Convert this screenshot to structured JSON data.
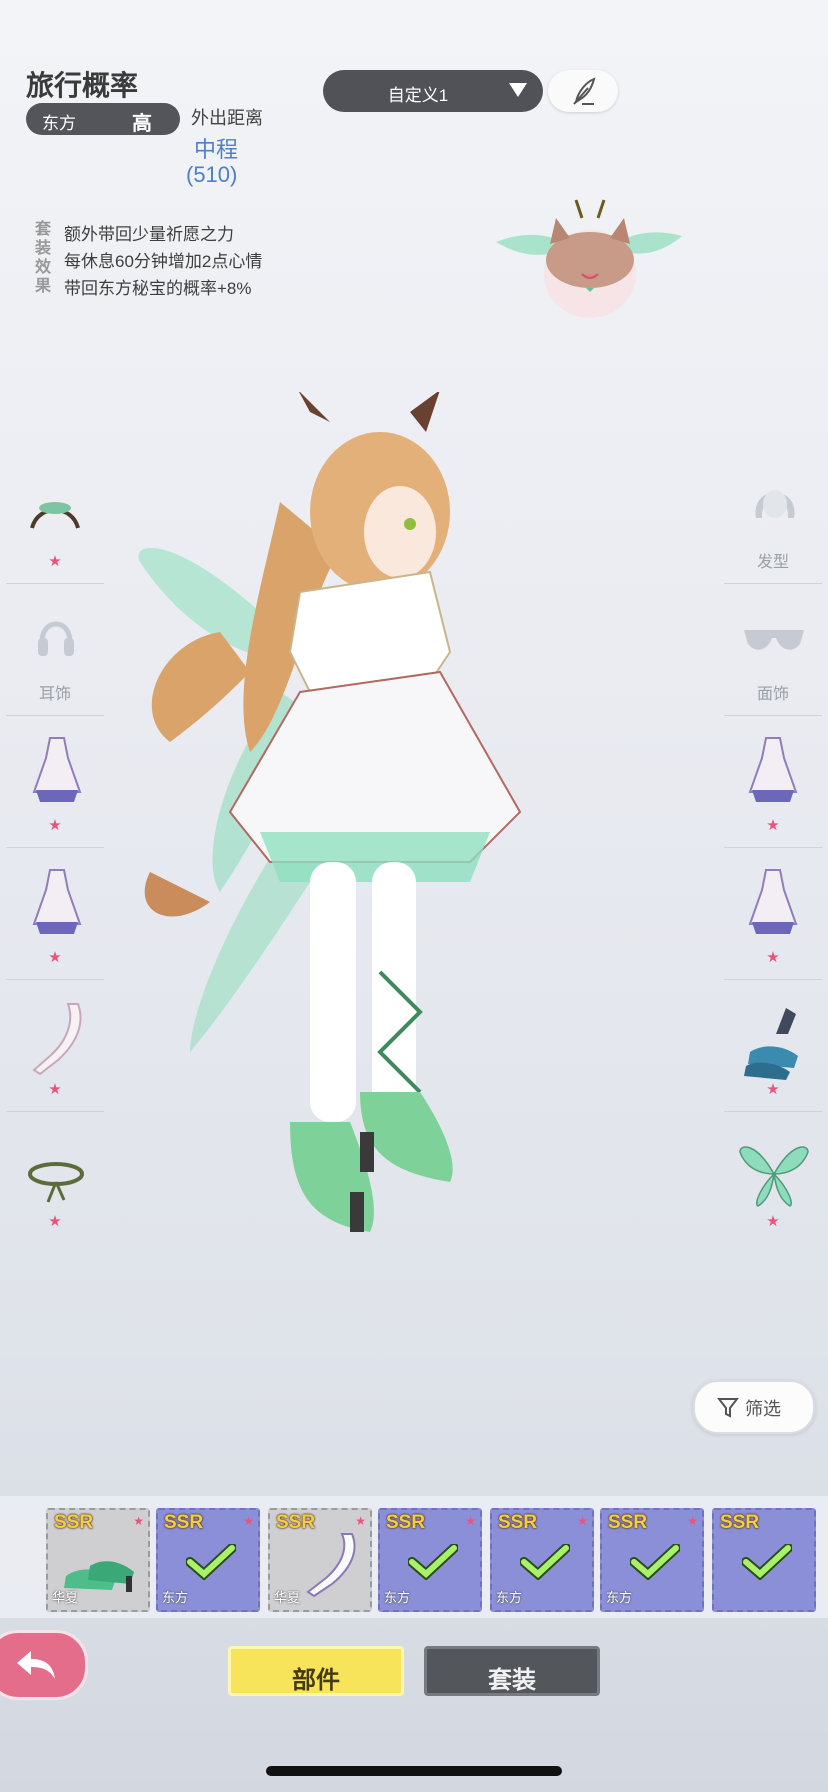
{
  "travel": {
    "title": "旅行概率",
    "region": "东方",
    "probability": "高",
    "distance_label": "外出距离",
    "distance_value": "中程",
    "distance_number": "(510)"
  },
  "set_effect": {
    "tag": "套装效果",
    "lines": [
      "额外带回少量祈愿之力",
      "每休息60分钟增加2点心情",
      "带回东方秘宝的概率+8%"
    ]
  },
  "preset": {
    "label": "自定义1"
  },
  "side_slots": {
    "left": [
      {
        "name": "headwear",
        "icon": "headpiece-icon",
        "star": "★"
      },
      {
        "name": "earrings",
        "label": "耳饰",
        "icon": "headphones-icon"
      },
      {
        "name": "dress-1",
        "icon": "dress-icon",
        "star": "★"
      },
      {
        "name": "dress-2",
        "icon": "dress-icon",
        "star": "★"
      },
      {
        "name": "stockings",
        "icon": "leg-icon",
        "star": "★"
      },
      {
        "name": "accessory",
        "icon": "rope-icon",
        "star": "★"
      }
    ],
    "right": [
      {
        "name": "hairstyle",
        "label": "发型",
        "icon": "hair-icon"
      },
      {
        "name": "face",
        "label": "面饰",
        "icon": "glasses-icon"
      },
      {
        "name": "dress-1",
        "icon": "dress-icon",
        "star": "★"
      },
      {
        "name": "dress-2",
        "icon": "dress-icon",
        "star": "★"
      },
      {
        "name": "shoes",
        "icon": "shoes-icon",
        "star": "★"
      },
      {
        "name": "wings",
        "icon": "wings-icon",
        "star": "★"
      }
    ]
  },
  "filter": {
    "label": "筛选"
  },
  "items": [
    {
      "rarity": "SSR",
      "tag": "华夏",
      "style": "cn",
      "icon": "shoes-icon",
      "equipped": false
    },
    {
      "rarity": "SSR",
      "tag": "东方",
      "style": "east",
      "icon": "headpiece-icon",
      "equipped": true
    },
    {
      "rarity": "SSR",
      "tag": "华夏",
      "style": "cn",
      "icon": "leg-icon",
      "equipped": false
    },
    {
      "rarity": "SSR",
      "tag": "东方",
      "style": "east",
      "icon": "leg-icon",
      "equipped": true
    },
    {
      "rarity": "SSR",
      "tag": "东方",
      "style": "east",
      "icon": "shoes-icon",
      "equipped": true
    },
    {
      "rarity": "SSR",
      "tag": "东方",
      "style": "east",
      "icon": "wings-icon",
      "equipped": true
    },
    {
      "rarity": "SSR",
      "tag": "",
      "style": "east",
      "icon": "dress-icon",
      "equipped": true
    }
  ],
  "tabs": {
    "parts": "部件",
    "set": "套装"
  },
  "colors": {
    "accent_blue": "#4f7fc5",
    "star_pink": "#e8557b",
    "tab_active": "#f7e45a",
    "tab_inactive": "#53565b"
  }
}
